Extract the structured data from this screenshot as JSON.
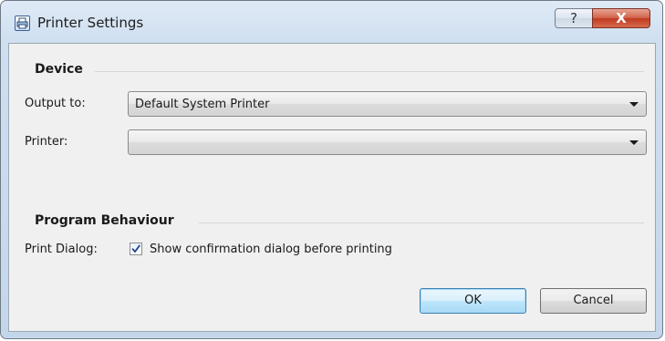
{
  "window": {
    "title": "Printer Settings",
    "help_label": "?",
    "close_label": "X"
  },
  "device": {
    "heading": "Device",
    "output_to_label": "Output to:",
    "output_to_value": "Default System Printer",
    "printer_label": "Printer:",
    "printer_value": ""
  },
  "behaviour": {
    "heading": "Program Behaviour",
    "print_dialog_label": "Print Dialog:",
    "confirm_checkbox_label": "Show confirmation dialog before printing",
    "confirm_checked": true
  },
  "buttons": {
    "ok_label": "OK",
    "cancel_label": "Cancel"
  },
  "icons": {
    "app": "printer-settings-icon",
    "help": "help-icon",
    "close": "close-icon",
    "dropdown": "chevron-down-icon",
    "check": "check-icon"
  },
  "colors": {
    "title_bar": "#cfdff0",
    "close_button": "#c9452a",
    "default_button_border": "#3c7fb1",
    "client_background": "#f0f0f0"
  }
}
